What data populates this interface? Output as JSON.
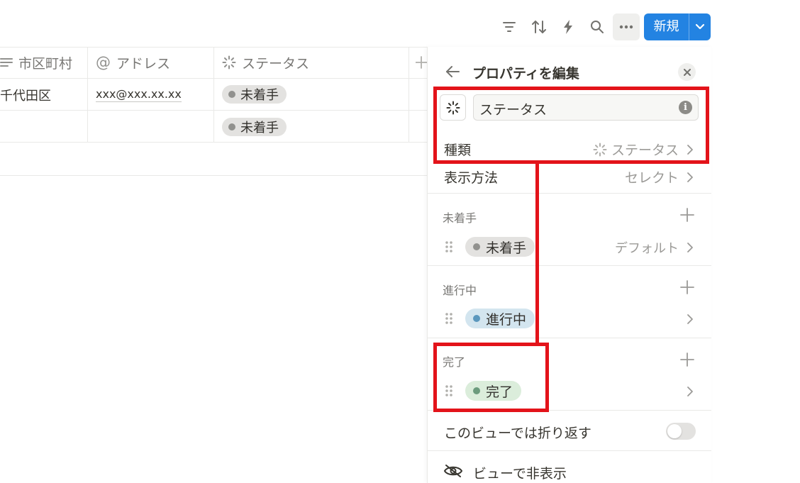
{
  "toolbar": {
    "icons": [
      "filter-icon",
      "sort-icon",
      "automation-icon",
      "search-icon",
      "more-icon"
    ],
    "new_label": "新規"
  },
  "table": {
    "columns": [
      {
        "label": "市区町村",
        "icon": "text-lines-icon"
      },
      {
        "label": "アドレス",
        "icon": "at-sign-icon"
      },
      {
        "label": "ステータス",
        "icon": "status-spinner-icon"
      }
    ],
    "rows": [
      {
        "city": "千代田区",
        "email": "xxx@xxx.xx.xx",
        "status": "未着手"
      },
      {
        "city": "",
        "email": "",
        "status": "未着手"
      }
    ]
  },
  "panel": {
    "title": "プロパティを編集",
    "name_value": "ステータス",
    "type_label": "種類",
    "type_value": "ステータス",
    "display_label": "表示方法",
    "display_value": "セレクト",
    "groups": [
      {
        "title": "未着手",
        "option": "未着手",
        "hint": "デフォルト",
        "dot": "#91918e",
        "bg": "#e3e2e0"
      },
      {
        "title": "進行中",
        "option": "進行中",
        "hint": "",
        "dot": "#5b97bd",
        "bg": "#d3e5ef"
      },
      {
        "title": "完了",
        "option": "完了",
        "hint": "",
        "dot": "#6c9b7d",
        "bg": "#dbeddb"
      }
    ],
    "wrap_label": "このビューでは折り返す",
    "hide_label": "ビューで非表示"
  },
  "colors": {
    "accent": "#2383e2",
    "highlight": "#e3131a"
  }
}
